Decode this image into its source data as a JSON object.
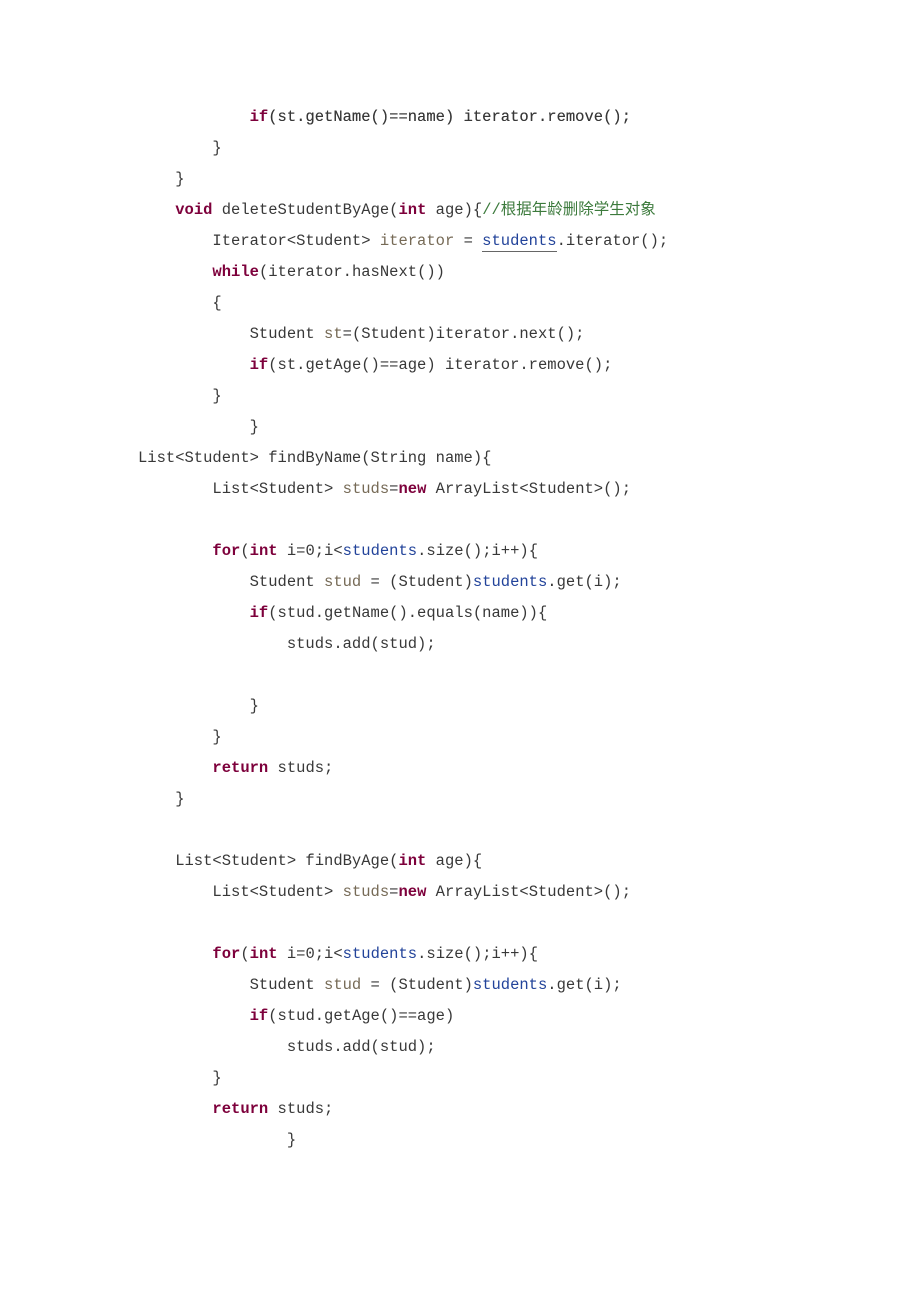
{
  "code": {
    "l1": "            if(st.getName()==name) iterator.remove();",
    "l2": "        }",
    "l3": "    }",
    "l4a": "    ",
    "l4_kw1": "void",
    "l4b": " deleteStudentByAge(",
    "l4_kw2": "int",
    "l4c": " age){",
    "l4_cmt": "//根据年龄删除学生对象",
    "l5a": "        Iterator<Student> ",
    "l5_lvar": "iterator",
    "l5b": " = ",
    "l5_var_ul": "students",
    "l5c": ".iterator();",
    "l6a": "        ",
    "l6_kw": "while",
    "l6b": "(iterator.hasNext())",
    "l7": "        {",
    "l8a": "            Student ",
    "l8_lvar": "st",
    "l8b": "=(Student)iterator.next();",
    "l9a": "            ",
    "l9_kw": "if",
    "l9b": "(st.getAge()==age) iterator.remove();",
    "l10": "        }",
    "l11": "            }",
    "l12": "List<Student> findByName(String name){",
    "l13a": "        List<Student> ",
    "l13_lvar": "studs",
    "l13b": "=",
    "l13_kw": "new",
    "l13c": " ArrayList<Student>();",
    "l14": "",
    "l15a": "        ",
    "l15_kw1": "for",
    "l15b": "(",
    "l15_kw2": "int",
    "l15c": " i=0;i<",
    "l15_var": "students",
    "l15d": ".size();i++){",
    "l16a": "            Student ",
    "l16_lvar": "stud",
    "l16b": " = (Student)",
    "l16_var": "students",
    "l16c": ".get(i);",
    "l17a": "            ",
    "l17_kw": "if",
    "l17b": "(stud.getName().equals(name)){",
    "l18": "                studs.add(stud);",
    "l19": "",
    "l20": "            }",
    "l21": "        }",
    "l22a": "        ",
    "l22_kw": "return",
    "l22b": " studs;",
    "l23": "    }",
    "l24": "",
    "l25a": "    List<Student> findByAge(",
    "l25_kw": "int",
    "l25b": " age){",
    "l26a": "        List<Student> ",
    "l26_lvar": "studs",
    "l26b": "=",
    "l26_kw": "new",
    "l26c": " ArrayList<Student>();",
    "l27": "",
    "l28a": "        ",
    "l28_kw1": "for",
    "l28b": "(",
    "l28_kw2": "int",
    "l28c": " i=0;i<",
    "l28_var": "students",
    "l28d": ".size();i++){",
    "l29a": "            Student ",
    "l29_lvar": "stud",
    "l29b": " = (Student)",
    "l29_var": "students",
    "l29c": ".get(i);",
    "l30a": "            ",
    "l30_kw": "if",
    "l30b": "(stud.getAge()==age)",
    "l31": "                studs.add(stud);",
    "l32": "        }",
    "l33a": "        ",
    "l33_kw": "return",
    "l33b": " studs;",
    "l34": "                }"
  }
}
